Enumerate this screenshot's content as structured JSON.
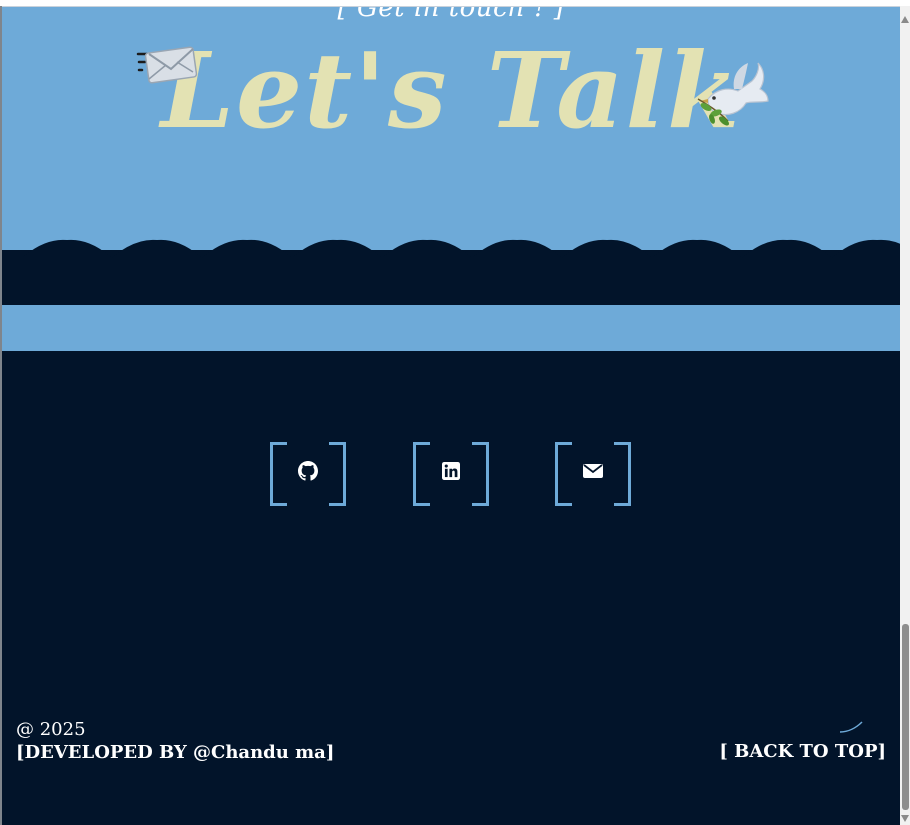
{
  "hero": {
    "subtitle": "[ Get in touch ! ]",
    "title": "Let's Talk",
    "left_icon": "envelope-icon",
    "right_icon": "dove-icon"
  },
  "socials": [
    {
      "name": "GitHub",
      "icon": "github-icon"
    },
    {
      "name": "LinkedIn",
      "icon": "linkedin-icon"
    },
    {
      "name": "Email",
      "icon": "envelope-icon"
    }
  ],
  "footer": {
    "year": "@ 2025",
    "developer": "[DEVELOPED BY @Chandu ma]",
    "back_to_top": "[ BACK TO TOP]"
  },
  "colors": {
    "background": "#02142a",
    "accent": "#6eaad8",
    "title": "#e3e2b3",
    "text": "#ffffff"
  }
}
